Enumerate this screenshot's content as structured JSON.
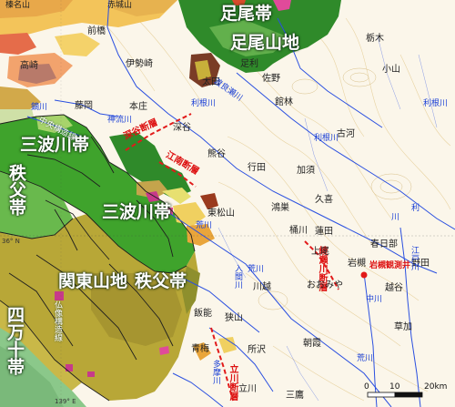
{
  "belts": {
    "ashio": "足尾帯",
    "ashio_mtn": "足尾山地",
    "sanbagawa_nw": "三波川帯",
    "chichibu_w": "秩父帯",
    "sanbagawa_c": "三波川帯",
    "kanto_mtn": "関東山地",
    "chichibu_s": "秩父帯",
    "shimanto": "四万十帯"
  },
  "tectonic_lines": {
    "chuo": "中央構造線",
    "butsuzo": "仏像構造線"
  },
  "faults": {
    "fukaya_a": "深谷断層",
    "fukaya_b": "江南断層",
    "ayasegawa": "綾瀬川断層",
    "iwatsuki": "岩槻観測井",
    "tachikawa": "立川断層"
  },
  "cities": {
    "tomioka": "富岡",
    "takasaki": "高崎",
    "maebashi": "前橋",
    "isesaki": "伊勢崎",
    "fujioka": "藤岡",
    "honjo": "本庄",
    "fukaya": "深谷",
    "kumagaya": "熊谷",
    "ota": "太田",
    "ashikaga": "足利",
    "sano": "佐野",
    "tatebayashi": "館林",
    "tochigi": "栃木",
    "oyama": "小山",
    "koga": "古河",
    "kazo": "加須",
    "gyoda": "行田",
    "kuki": "久喜",
    "konosu": "鴻巣",
    "higashimatsuyama": "東松山",
    "okegawa": "桶川",
    "hasuda": "蓮田",
    "ageo": "上尾",
    "kasukabe": "春日部",
    "iwatsuki": "岩槻",
    "noda": "野田",
    "omiya": "おおみや",
    "koshigaya": "越谷",
    "kawagoe": "川越",
    "sayama": "狭山",
    "hanno": "飯能",
    "tokorozawa": "所沢",
    "asaka": "朝霞",
    "soka": "草加",
    "ome": "青梅",
    "tachikawa": "立川",
    "mitaka": "三鷹"
  },
  "rivers": {
    "tone1": "利根川",
    "tone2": "利根川",
    "tone3": "利",
    "tone4": "利根川",
    "watarase": "渡良瀬川",
    "kanna": "神流川",
    "kabura": "鏑川",
    "ara1": "荒川",
    "ara2": "荒川",
    "ara3": "荒川",
    "iruma": "入間川",
    "edo": "江戸川",
    "naka": "中川",
    "kinu": "川",
    "tama": "多摩川"
  },
  "mountains": {
    "haruna": "榛名山",
    "akagi": "赤城山"
  },
  "coords": {
    "lat": "36° N",
    "lon": "139° E"
  },
  "scale": {
    "t0": "0",
    "t1": "10",
    "t2": "20km"
  },
  "colors": {
    "plain": "#fbf6ea",
    "sanbagawa": "#3fa32c",
    "chichibu": "#b8a737",
    "shimanto": "#8bc88a",
    "river": "#1a3fd6",
    "fault": "#e21a1a"
  }
}
